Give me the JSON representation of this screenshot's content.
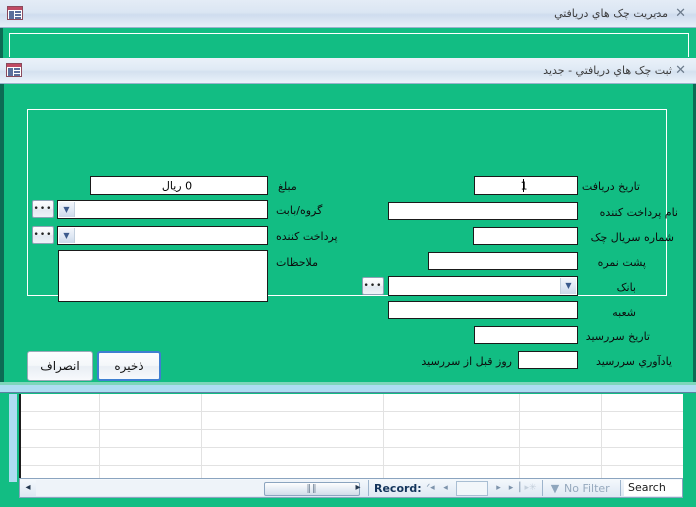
{
  "outer_window": {
    "title": "مديريت چک هاي دريافتي",
    "icon": "access-form-icon",
    "minimize_label": "–",
    "close_label": "✕"
  },
  "modal_window": {
    "title": "ثبت چک هاي دريافتي - جديد",
    "icon": "access-form-icon",
    "close_label": "✕"
  },
  "form": {
    "right_column": [
      {
        "label": "تاريخ دريافت",
        "value": "1",
        "type": "textbox"
      },
      {
        "label": "نام پرداخت کننده",
        "value": "",
        "type": "textbox"
      },
      {
        "label": "شماره سريال چک",
        "value": "",
        "type": "textbox"
      },
      {
        "label": "پشت نمره",
        "value": "",
        "type": "textbox"
      },
      {
        "label": "بانک",
        "value": "",
        "type": "combo"
      },
      {
        "label": "شعبه",
        "value": "",
        "type": "textbox"
      },
      {
        "label": "تاريخ سررسيد",
        "value": "",
        "type": "textbox"
      },
      {
        "label": "يادآوري سررسيد",
        "value": "",
        "type": "textbox",
        "suffix": "روز قبل از سررسيد"
      }
    ],
    "left_column": [
      {
        "label": "مبلغ",
        "value": "0 ريال",
        "type": "textbox"
      },
      {
        "label": "گروه/بابت",
        "value": "",
        "type": "combo"
      },
      {
        "label": "پرداخت کننده",
        "value": "",
        "type": "combo"
      },
      {
        "label": "ملاحظات",
        "value": "",
        "type": "memo"
      }
    ],
    "ellipsis_label": "•••",
    "dropdown_icon": "chevron-down-icon"
  },
  "actions": {
    "save_label": "ذخيره",
    "cancel_label": "انصراف"
  },
  "statusbar": {
    "record_label": "Record:",
    "record_value": "",
    "first_icon": "ᐟ◂",
    "prev_icon": "◂",
    "next_icon": "▸",
    "last_icon": "▸▕",
    "new_icon": "▸✳",
    "filter_icon": "filter-icon",
    "filter_label": "No Filter",
    "search_placeholder": "Search",
    "search_value": "Search",
    "scroll_left_icon": "◂",
    "scroll_right_icon": "▸",
    "thumb_grip": "‖‖"
  },
  "colors": {
    "form_green": "#12bd83",
    "dark_green_edge": "#0c6b54",
    "titlebar_blue": "#e0eaf5",
    "focus_blue": "#3f7fd1"
  }
}
